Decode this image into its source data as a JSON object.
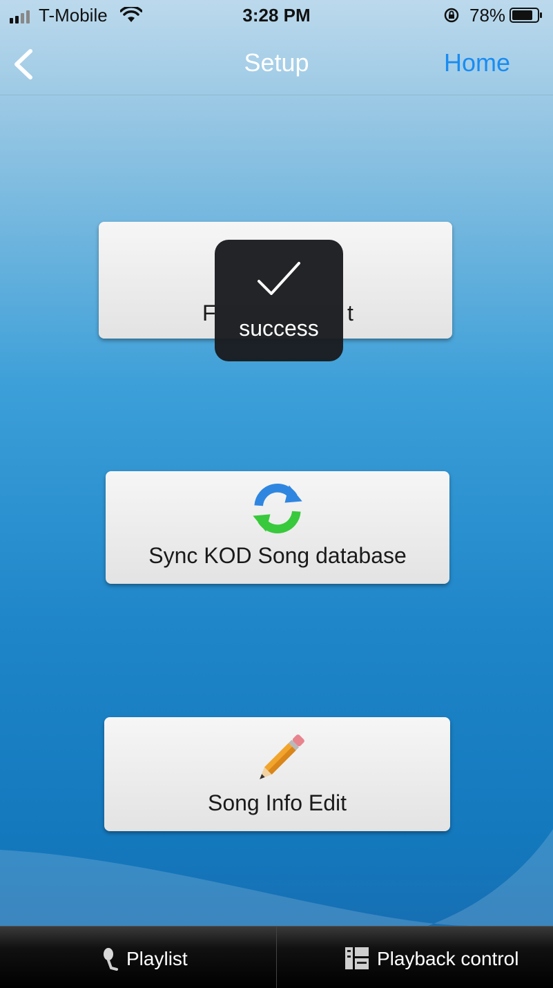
{
  "status_bar": {
    "carrier": "T-Mobile",
    "time": "3:28 PM",
    "battery_percent": "78%",
    "icons": [
      "signal-icon",
      "wifi-icon",
      "orientation-lock-icon",
      "battery-icon"
    ]
  },
  "nav": {
    "title": "Setup",
    "home_label": "Home",
    "back_icon": "chevron-left-icon",
    "home_color": "#1a8cf0"
  },
  "buttons": [
    {
      "label_visible_start": "F",
      "label_visible_end": "t",
      "icon": null
    },
    {
      "label": "Sync KOD Song database",
      "icon": "sync-arrows-icon"
    },
    {
      "label": "Song Info Edit",
      "icon": "pencil-icon"
    }
  ],
  "toast": {
    "text": "success",
    "icon": "checkmark-icon"
  },
  "tabs": [
    {
      "label": "Playlist",
      "icon": "microphone-icon"
    },
    {
      "label": "Playback control",
      "icon": "playback-control-icon"
    }
  ]
}
